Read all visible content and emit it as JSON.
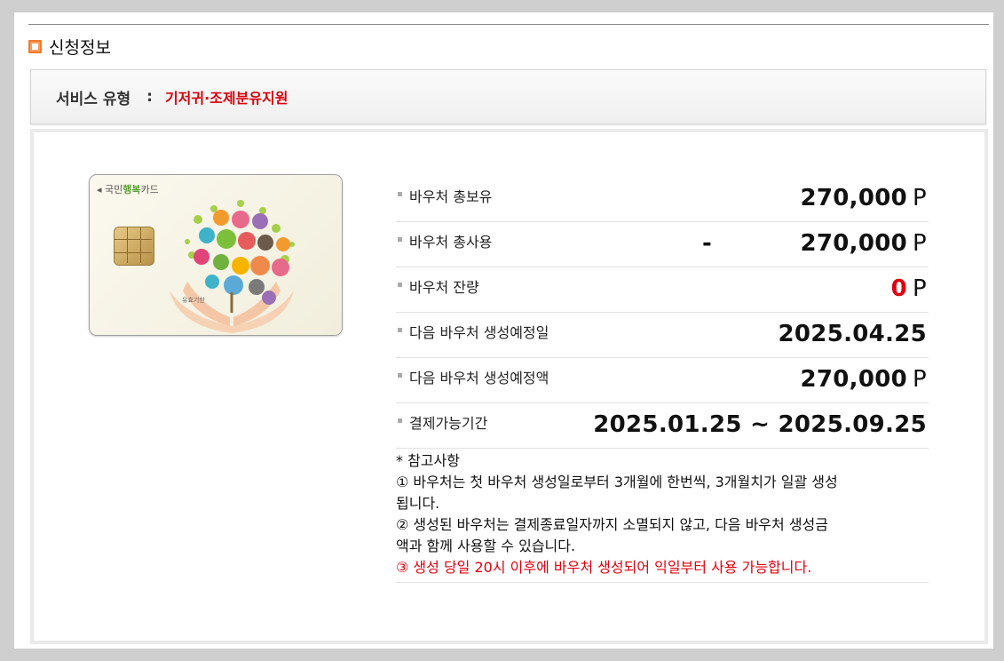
{
  "section": {
    "title": "신청정보"
  },
  "service": {
    "label": "서비스 유형",
    "colon": ":",
    "value": "기저귀·조제분유지원"
  },
  "card": {
    "brand_prefix": "국민",
    "brand_accent": "행복",
    "brand_suffix": "카드",
    "validity_label": "유효기한"
  },
  "rows": [
    {
      "label": "바우처 총보유",
      "value": "270,000",
      "unit": "P",
      "prefix": ""
    },
    {
      "label": "바우처 총사용",
      "value": "270,000",
      "unit": "P",
      "prefix": "-"
    },
    {
      "label": "바우처 잔량",
      "value": "0",
      "unit": "P",
      "prefix": ""
    },
    {
      "label": "다음 바우처 생성예정일",
      "value": "2025.04.25",
      "unit": "",
      "prefix": ""
    },
    {
      "label": "다음 바우처 생성예정액",
      "value": "270,000",
      "unit": "P",
      "prefix": ""
    },
    {
      "label": "결제가능기간",
      "value": "2025.01.25 ~ 2025.09.25",
      "unit": "",
      "prefix": ""
    }
  ],
  "notes": {
    "title": "* 참고사항",
    "line1a": "① 바우처는 첫 바우처 생성일로부터 3개월에 한번씩, 3개월치가 일괄 생성",
    "line1b": "됩니다.",
    "line2a": "② 생성된 바우처는 결제종료일자까지 소멸되지 않고, 다음 바우처 생성금",
    "line2b": "액과 함께 사용할 수 있습니다.",
    "line3": "③ 생성 당일 20시 이후에 바우처 생성되어 익일부터 사용 가능합니다."
  },
  "colors": {
    "accent_red": "#e0000f",
    "orange_icon": "#f07a2a"
  }
}
